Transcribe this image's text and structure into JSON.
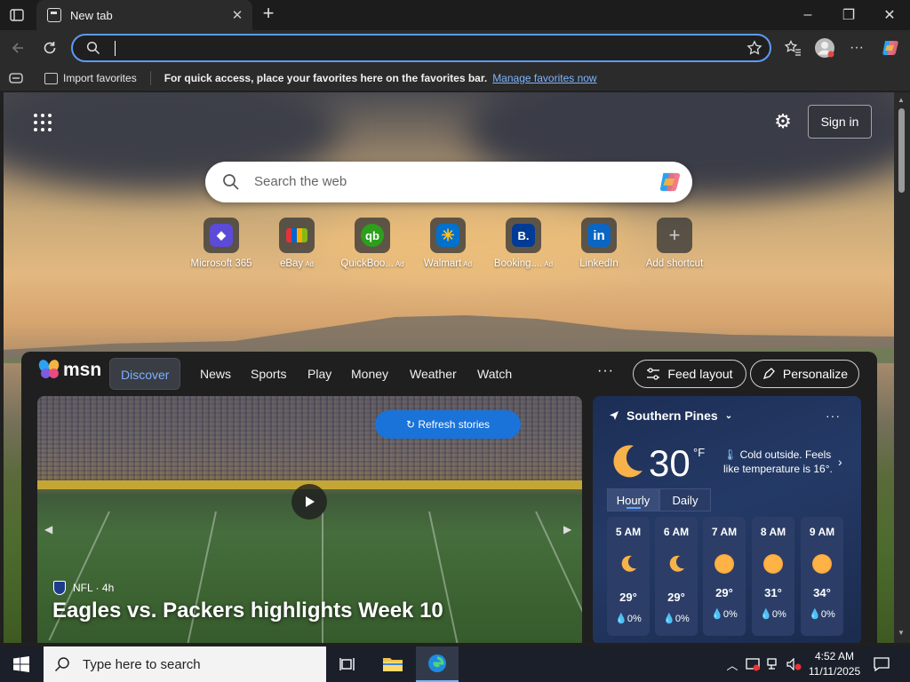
{
  "browser": {
    "tab_title": "New tab",
    "tab_close": "✕",
    "new_tab": "+",
    "window_controls": {
      "minimize": "–",
      "restore": "❐",
      "close": "✕"
    },
    "favbar": {
      "import_label": "Import favorites",
      "message": "For quick access, place your favorites here on the favorites bar.",
      "manage_link": "Manage favorites now"
    }
  },
  "newtab": {
    "sign_in": "Sign in",
    "search_placeholder": "Search the web",
    "shortcuts": [
      {
        "label": "Microsoft 365",
        "ad": "",
        "icon": "microsoft-365-icon",
        "color": "#5b4bd6"
      },
      {
        "label": "eBay",
        "ad": "Ad",
        "icon": "ebay-icon",
        "color": "#3a3a3a"
      },
      {
        "label": "QuickBoo...",
        "ad": "Ad",
        "icon": "quickbooks-icon",
        "color": "#2ca01c"
      },
      {
        "label": "Walmart",
        "ad": "Ad",
        "icon": "walmart-icon",
        "color": "#0071ce"
      },
      {
        "label": "Booking....",
        "ad": "Ad",
        "icon": "booking-icon",
        "color": "#003b95"
      },
      {
        "label": "LinkedIn",
        "ad": "",
        "icon": "linkedin-icon",
        "color": "#0a66c2"
      },
      {
        "label": "Add shortcut",
        "ad": "",
        "icon": "plus-icon",
        "color": "#555555"
      }
    ]
  },
  "feed": {
    "logo": "msn",
    "tabs": [
      "Discover",
      "News",
      "Sports",
      "Play",
      "Money",
      "Weather",
      "Watch"
    ],
    "more": "···",
    "feed_layout": "Feed layout",
    "personalize": "Personalize",
    "hero": {
      "refresh": "Refresh stories",
      "source": "NFL · 4h",
      "headline": "Eagles vs. Packers highlights Week 10"
    },
    "weather": {
      "location": "Southern Pines",
      "temp": "30",
      "unit": "°F",
      "condition": "Cold outside. Feels like temperature is 16°.",
      "tabs": [
        "Hourly",
        "Daily"
      ],
      "hours": [
        {
          "time": "5 AM",
          "temp": "29°",
          "precip": "💧0%",
          "icon": "moon-icon"
        },
        {
          "time": "6 AM",
          "temp": "29°",
          "precip": "💧0%",
          "icon": "moon-icon"
        },
        {
          "time": "7 AM",
          "temp": "29°",
          "precip": "💧0%",
          "icon": "sun-icon"
        },
        {
          "time": "8 AM",
          "temp": "31°",
          "precip": "💧0%",
          "icon": "sun-icon"
        },
        {
          "time": "9 AM",
          "temp": "34°",
          "precip": "💧0%",
          "icon": "sun-icon"
        }
      ]
    }
  },
  "taskbar": {
    "search_placeholder": "Type here to search",
    "time": "4:52 AM",
    "date": "11/11/2025"
  },
  "colors": {
    "accent": "#5b9bf5",
    "link": "#7eb4ff",
    "refresh_button": "#1a73d9"
  }
}
